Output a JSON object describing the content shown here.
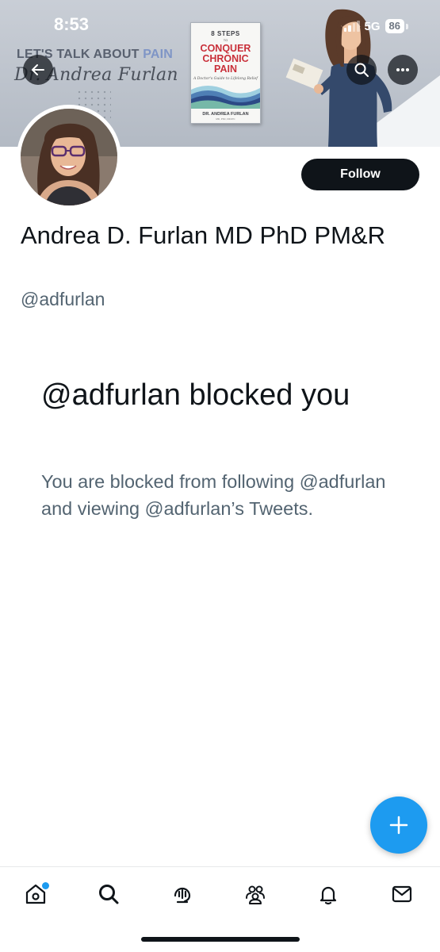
{
  "status_bar": {
    "time": "8:53",
    "network": "5G",
    "battery": "86"
  },
  "banner": {
    "brand_prefix": "LET'S TALK ABOUT ",
    "brand_accent": "PAIN",
    "brand_signature": "Dr. Andrea Furlan",
    "book": {
      "top": "8 STEPS",
      "to": "TO",
      "title_line1": "CONQUER",
      "title_line2": "CHRONIC",
      "title_line3": "PAIN",
      "subtitle": "A Doctor's Guide to Lifelong Relief",
      "author": "DR. ANDREA FURLAN",
      "credentials": "MD, PhD, FRCPC"
    }
  },
  "profile": {
    "follow_label": "Follow",
    "display_name": "Andrea D. Furlan MD PhD PM&R",
    "handle": "@adfurlan"
  },
  "blocked": {
    "title": "@adfurlan blocked you",
    "description": "You are blocked from following @adfurlan and viewing @adfurlan’s Tweets."
  },
  "icons": {
    "back": "arrow-left-icon",
    "search": "search-icon",
    "more": "more-icon",
    "compose": "plus-icon",
    "nav": [
      "home-icon",
      "search-icon",
      "spaces-icon",
      "communities-icon",
      "notifications-icon",
      "messages-icon"
    ]
  },
  "colors": {
    "accent": "#1d9bf0",
    "text_primary": "#0f1419",
    "text_secondary": "#536471",
    "follow_bg": "#0f1419"
  }
}
